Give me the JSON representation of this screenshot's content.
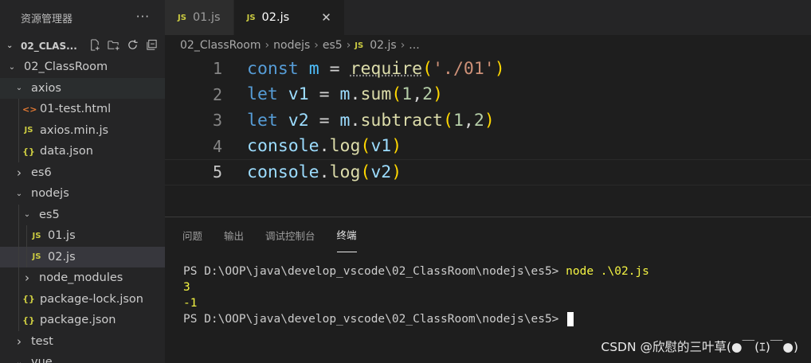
{
  "sidebar": {
    "title": "资源管理器",
    "more": "···",
    "folder": "02_CLAS...",
    "actions": [
      "new-file",
      "new-folder",
      "refresh",
      "collapse-all"
    ],
    "tree": [
      {
        "label": "02_ClassRoom",
        "type": "folder",
        "open": true,
        "depth": 1
      },
      {
        "label": "axios",
        "type": "folder",
        "open": true,
        "depth": 2
      },
      {
        "label": "01-test.html",
        "type": "html",
        "depth": 3
      },
      {
        "label": "axios.min.js",
        "type": "js",
        "depth": 3
      },
      {
        "label": "data.json",
        "type": "json",
        "depth": 3
      },
      {
        "label": "es6",
        "type": "folder",
        "open": false,
        "depth": 2
      },
      {
        "label": "nodejs",
        "type": "folder",
        "open": true,
        "depth": 2
      },
      {
        "label": "es5",
        "type": "folder",
        "open": true,
        "depth": 3
      },
      {
        "label": "01.js",
        "type": "js",
        "depth": 4
      },
      {
        "label": "02.js",
        "type": "js",
        "depth": 4,
        "selected": true
      },
      {
        "label": "node_modules",
        "type": "folder",
        "open": false,
        "depth": 3
      },
      {
        "label": "package-lock.json",
        "type": "json",
        "depth": 3
      },
      {
        "label": "package.json",
        "type": "json",
        "depth": 3
      },
      {
        "label": "test",
        "type": "folder",
        "open": false,
        "depth": 2
      },
      {
        "label": "vue",
        "type": "folder",
        "open": true,
        "depth": 2
      }
    ]
  },
  "tabs": [
    {
      "label": "01.js",
      "icon": "JS",
      "active": false
    },
    {
      "label": "02.js",
      "icon": "JS",
      "active": true,
      "close": "✕"
    }
  ],
  "breadcrumb": {
    "items": [
      "02_ClassRoom",
      "nodejs",
      "es5"
    ],
    "file": "02.js",
    "tail": "..."
  },
  "editor": {
    "line_numbers": [
      "1",
      "2",
      "3",
      "4",
      "5"
    ],
    "current_line": 5
  },
  "panel": {
    "tabs": [
      "问题",
      "输出",
      "调试控制台",
      "终端"
    ],
    "active_tab": "终端",
    "terminal": {
      "prompt1": "PS D:\\OOP\\java\\develop_vscode\\02_ClassRoom\\nodejs\\es5> ",
      "command": "node .\\02.js",
      "out1": "3",
      "out2": "-1",
      "prompt2": "PS D:\\OOP\\java\\develop_vscode\\02_ClassRoom\\nodejs\\es5> "
    }
  },
  "watermark": "CSDN @欣慰的三叶草(●￣(ｴ)￣●)"
}
